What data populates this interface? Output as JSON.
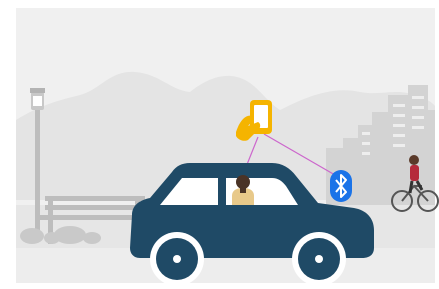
{
  "illustration": {
    "icons": {
      "hand": "hand-holding-phone-icon",
      "bluetooth": "bluetooth-icon"
    },
    "colors": {
      "background": "#ffffff",
      "scene_bg": "#f0f0f0",
      "hills": "#e4e4e4",
      "ground": "#e6e6e6",
      "buildings": "#d3d3d3",
      "park": "#c9c9c9",
      "car_body": "#1f4a66",
      "car_window": "#ffffff",
      "wheel": "#1f4a66",
      "hub": "#ffffff",
      "phone_accent": "#f5b400",
      "bluetooth": "#1a73e8",
      "connection_line": "#cc66cc",
      "cyclist_shirt": "#b52a3a"
    }
  }
}
